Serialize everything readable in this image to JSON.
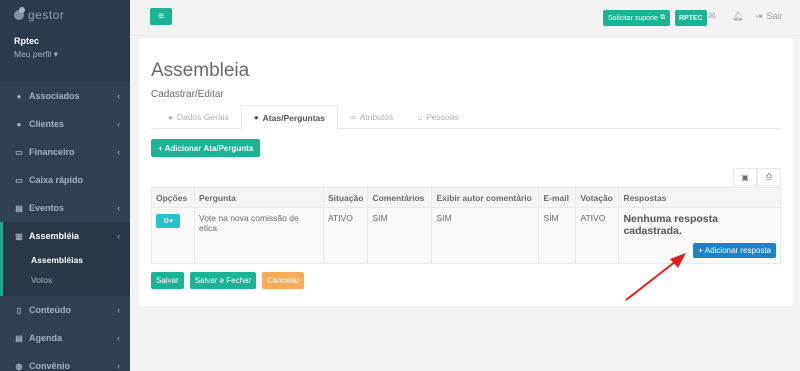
{
  "sidebar": {
    "logo": "gestor",
    "user_name": "Rptec",
    "profile_label": "Meu perfil ▾",
    "items": [
      {
        "label": "Associados",
        "icon": "users-icon",
        "glyph": "👥"
      },
      {
        "label": "Clientes",
        "icon": "users-icon",
        "glyph": "👥"
      },
      {
        "label": "Financeiro",
        "icon": "money-icon",
        "glyph": "▭"
      },
      {
        "label": "Caixa rápido",
        "icon": "cash-icon",
        "glyph": "▭"
      },
      {
        "label": "Eventos",
        "icon": "calendar-icon",
        "glyph": "▤"
      },
      {
        "label": "Assembléia",
        "icon": "book-icon",
        "glyph": "▥"
      },
      {
        "label": "Conteúdo",
        "icon": "file-icon",
        "glyph": "▯"
      },
      {
        "label": "Agenda",
        "icon": "calendar-icon",
        "glyph": "▤"
      },
      {
        "label": "Convênio",
        "icon": "globe-icon",
        "glyph": "◍"
      }
    ],
    "sub_items": [
      "Assembléias",
      "Votos"
    ]
  },
  "topbar": {
    "support_label": "Solicitar suporte",
    "account_label": "RPTEC",
    "logout_label": "Sair"
  },
  "page": {
    "title": "Assembleia",
    "subtitle": "Cadastrar/Editar",
    "tabs": [
      {
        "label": "Dados Gerais",
        "icon": "user-icon",
        "glyph": "●"
      },
      {
        "label": "Atas/Perguntas",
        "icon": "question-icon",
        "glyph": "❓"
      },
      {
        "label": "Atributos",
        "icon": "link-icon",
        "glyph": "∞"
      },
      {
        "label": "Pessoas",
        "icon": "home-icon",
        "glyph": "⌂"
      }
    ],
    "add_button": "+ Adicionar Ata/Pergunta"
  },
  "table": {
    "headers": [
      "Opções",
      "Pergunta",
      "Situação",
      "Comentários",
      "Exibir autor comentário",
      "E-mail",
      "Votação",
      "Respostas"
    ],
    "rows": [
      {
        "pergunta": "Vote na nova comissão de etica",
        "situacao": "ATIVO",
        "comentarios": "SIM",
        "exibir_autor": "SIM",
        "email": "SIM",
        "votacao": "ATIVO",
        "respostas_empty": "Nenhuma resposta cadastrada.",
        "add_response": "+ Adicionar resposta"
      }
    ]
  },
  "footer": {
    "save": "Salvar",
    "save_close": "Salvar e Fechar",
    "cancel": "Cancelar"
  },
  "colors": {
    "primary": "#1ab394",
    "info": "#23c6c8",
    "blue": "#1c84c6",
    "warning": "#f8ac59",
    "sidebar": "#2f4050",
    "annotation_arrow": "#e02020"
  }
}
